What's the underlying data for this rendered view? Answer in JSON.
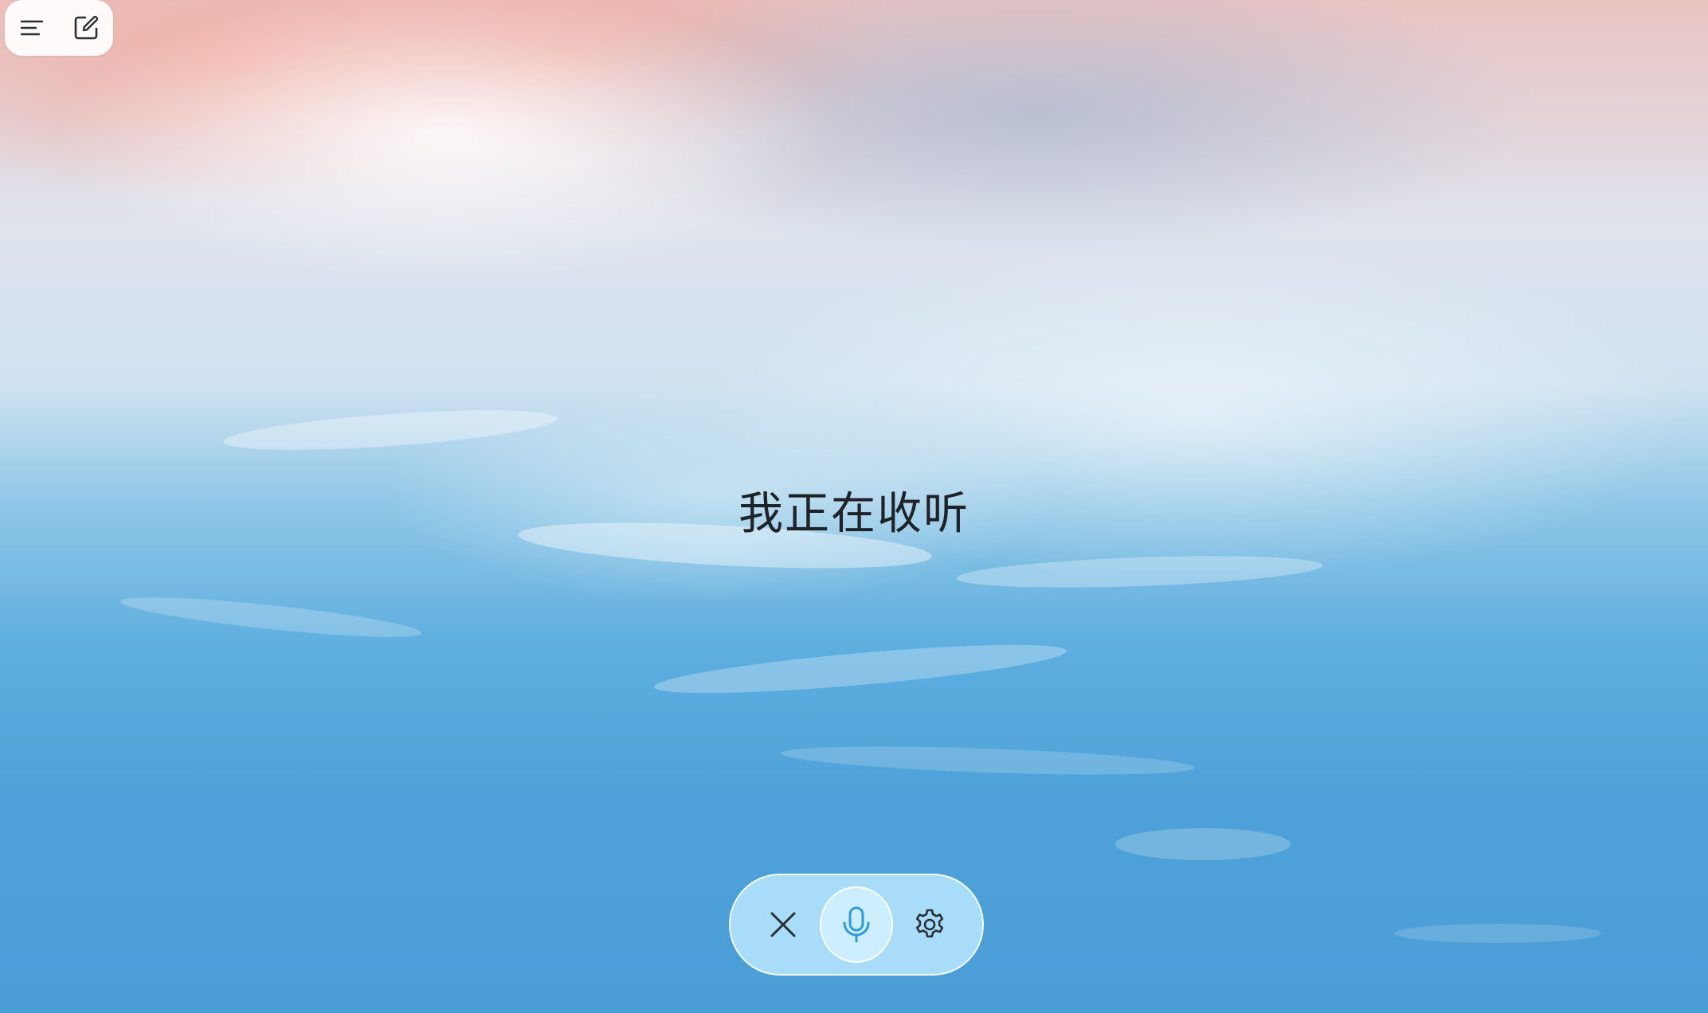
{
  "header": {
    "menu_icon": "menu-icon",
    "new_chat_icon": "edit-icon"
  },
  "main": {
    "status_text": "我正在收听"
  },
  "voice_controls": {
    "close_icon": "close-icon",
    "mic_icon": "microphone-icon",
    "settings_icon": "gear-icon"
  },
  "colors": {
    "controls_bg": "#a9dcf8",
    "mic_bg": "#cdeefe",
    "icon_color": "#2b3035",
    "mic_icon_color": "#2e9bd6"
  }
}
